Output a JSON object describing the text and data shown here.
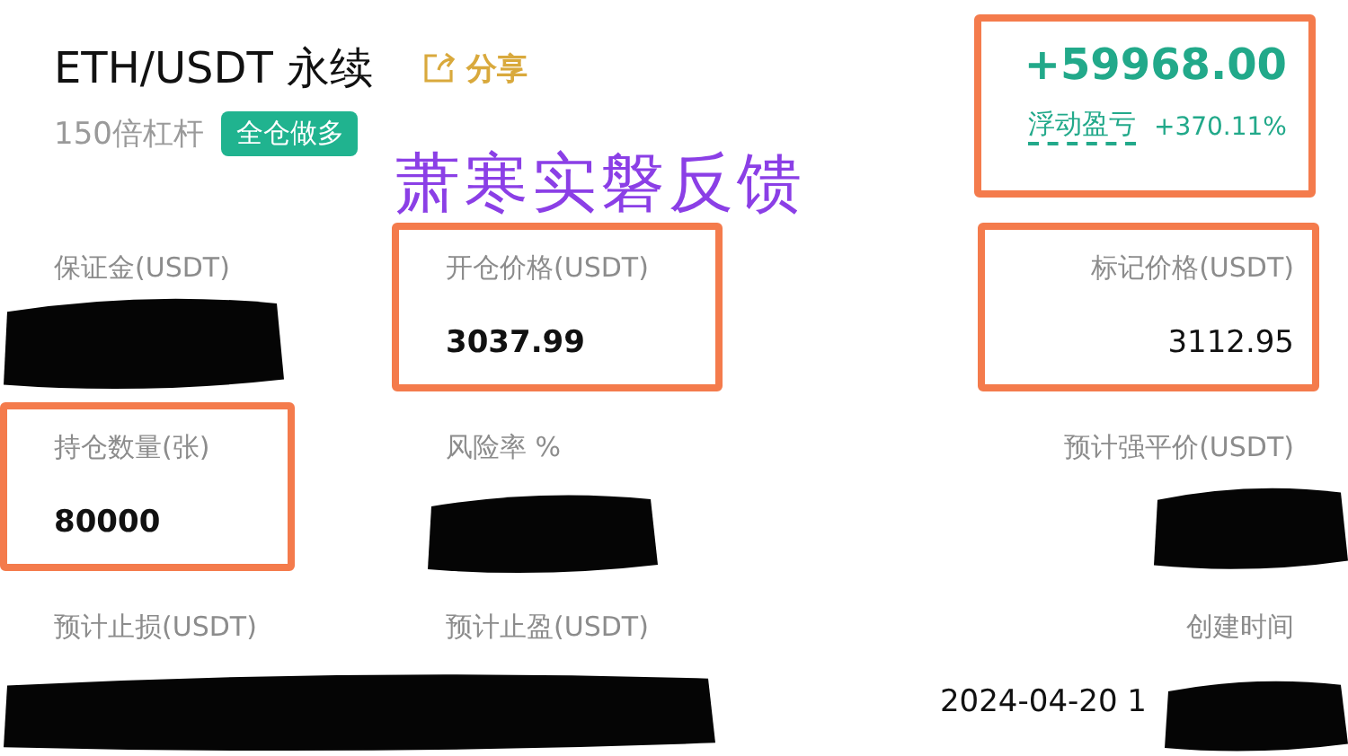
{
  "header": {
    "title": "ETH/USDT 永续",
    "share": "分享",
    "leverage": "150倍杠杆",
    "mode_badge": "全仓做多"
  },
  "pnl": {
    "amount": "+59968.00",
    "label": "浮动盈亏",
    "percent": "+370.11%",
    "highlighted": true
  },
  "overlay_caption": "萧寒实磐反馈",
  "fields": [
    {
      "label": "保证金(USDT)",
      "highlighted": false
    },
    {
      "label": "开仓价格(USDT)",
      "value": "3037.99",
      "highlighted": true
    },
    {
      "label": "标记价格(USDT)",
      "value": "3112.95",
      "highlighted": true
    },
    {
      "label": "持仓数量(张)",
      "value": "80000",
      "highlighted": true
    },
    {
      "label": "风险率 %",
      "highlighted": false
    },
    {
      "label": "预计强平价(USDT)",
      "highlighted": false
    },
    {
      "label": "预计止损(USDT)",
      "highlighted": false
    },
    {
      "label": "预计止盈(USDT)",
      "highlighted": false
    },
    {
      "label": "创建时间",
      "value": "2024-04-20 1",
      "highlighted": false
    }
  ]
}
